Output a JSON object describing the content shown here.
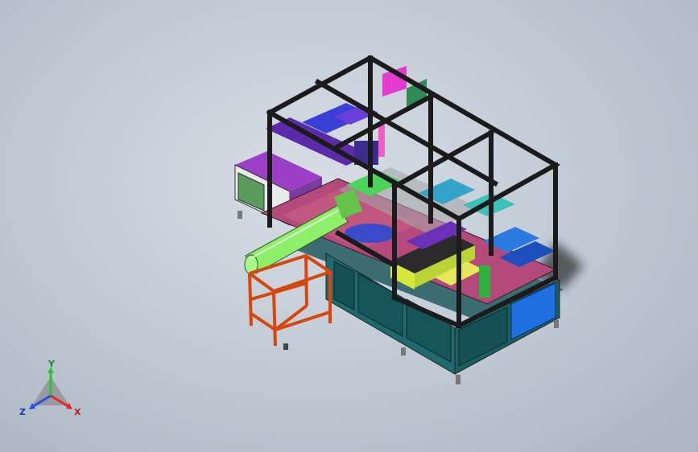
{
  "viewport": {
    "background_top": "#d7dde4",
    "background_bottom": "#aab5c2"
  },
  "triad": {
    "x_label": "X",
    "y_label": "Y",
    "z_label": "Z",
    "x_color": "#e8262a",
    "y_color": "#2fbf3a",
    "z_color": "#2c4ee0"
  },
  "model": {
    "frame_color": "#1b1b1b",
    "cabinet_color": "#1f6a6e",
    "door_color": "#1a5a5e",
    "table_color": "#9b2d5d",
    "stand_color": "#f05a1e",
    "tube_color": "#8ef06a",
    "side_box_purple": "#8c2fb0",
    "side_box_green": "#5a9a5a",
    "blue_panel": "#1e6fe0"
  }
}
